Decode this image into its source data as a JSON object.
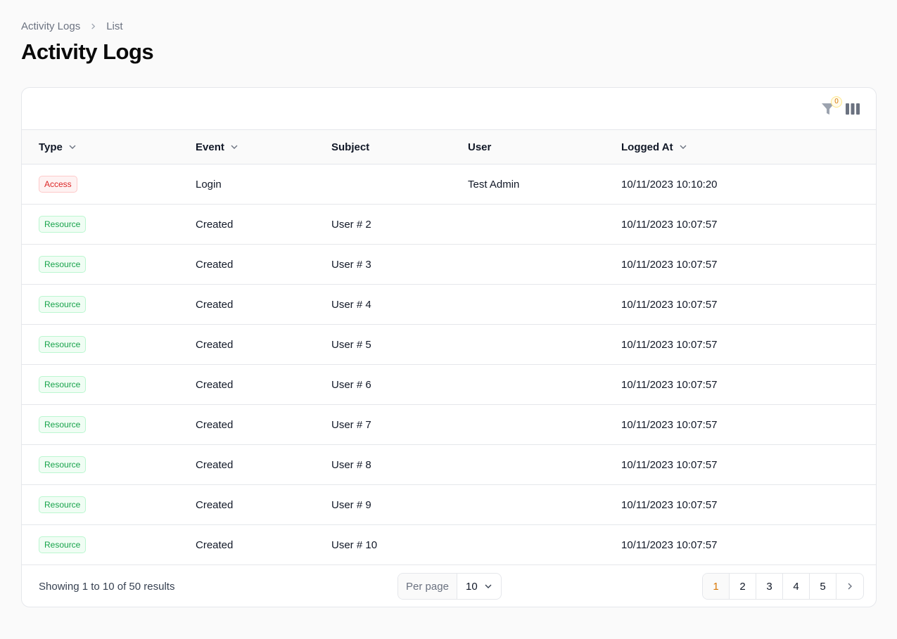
{
  "breadcrumb": {
    "items": [
      "Activity Logs",
      "List"
    ]
  },
  "page": {
    "title": "Activity Logs"
  },
  "toolbar": {
    "filter_count": "0",
    "filter_icon": "filter-icon",
    "columns_icon": "columns-icon"
  },
  "table": {
    "headers": {
      "type": "Type",
      "event": "Event",
      "subject": "Subject",
      "user": "User",
      "logged_at": "Logged At"
    },
    "rows": [
      {
        "type": "Access",
        "type_color": "#dc2626",
        "event": "Login",
        "subject": "",
        "user": "Test Admin",
        "logged_at": "10/11/2023 10:10:20"
      },
      {
        "type": "Resource",
        "type_color": "#16a34a",
        "event": "Created",
        "subject": "User # 2",
        "user": "",
        "logged_at": "10/11/2023 10:07:57"
      },
      {
        "type": "Resource",
        "type_color": "#16a34a",
        "event": "Created",
        "subject": "User # 3",
        "user": "",
        "logged_at": "10/11/2023 10:07:57"
      },
      {
        "type": "Resource",
        "type_color": "#16a34a",
        "event": "Created",
        "subject": "User # 4",
        "user": "",
        "logged_at": "10/11/2023 10:07:57"
      },
      {
        "type": "Resource",
        "type_color": "#16a34a",
        "event": "Created",
        "subject": "User # 5",
        "user": "",
        "logged_at": "10/11/2023 10:07:57"
      },
      {
        "type": "Resource",
        "type_color": "#16a34a",
        "event": "Created",
        "subject": "User # 6",
        "user": "",
        "logged_at": "10/11/2023 10:07:57"
      },
      {
        "type": "Resource",
        "type_color": "#16a34a",
        "event": "Created",
        "subject": "User # 7",
        "user": "",
        "logged_at": "10/11/2023 10:07:57"
      },
      {
        "type": "Resource",
        "type_color": "#16a34a",
        "event": "Created",
        "subject": "User # 8",
        "user": "",
        "logged_at": "10/11/2023 10:07:57"
      },
      {
        "type": "Resource",
        "type_color": "#16a34a",
        "event": "Created",
        "subject": "User # 9",
        "user": "",
        "logged_at": "10/11/2023 10:07:57"
      },
      {
        "type": "Resource",
        "type_color": "#16a34a",
        "event": "Created",
        "subject": "User # 10",
        "user": "",
        "logged_at": "10/11/2023 10:07:57"
      }
    ]
  },
  "footer": {
    "summary": "Showing 1 to 10 of 50 results",
    "per_page_label": "Per page",
    "per_page_value": "10",
    "pages": [
      "1",
      "2",
      "3",
      "4",
      "5"
    ],
    "active_page": "1"
  },
  "colors": {
    "accent": "#d97706",
    "access": "#dc2626",
    "resource": "#16a34a"
  }
}
